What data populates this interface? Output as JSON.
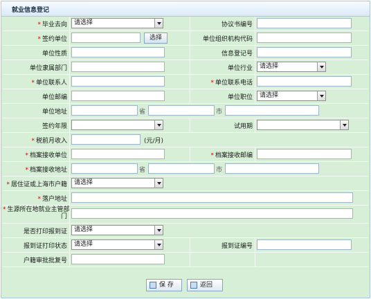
{
  "header": {
    "title": "就业信息登记"
  },
  "rows": {
    "r1": {
      "left_label": "毕业去向",
      "left_select": "请选择",
      "right_label": "协议书编号"
    },
    "r2": {
      "left_label": "签约单位",
      "choose_button": "选择",
      "right_label": "单位组织机构代码"
    },
    "r3": {
      "left_label": "单位性质",
      "right_label": "信息登记号"
    },
    "r4": {
      "left_label": "单位隶属部门",
      "right_label": "单位行业",
      "right_select": "请选择"
    },
    "r5": {
      "left_label": "单位联系人",
      "right_label": "单位联系电话"
    },
    "r6": {
      "left_label": "单位邮编",
      "right_label": "单位职位",
      "right_select": "请选择"
    },
    "r7": {
      "left_label": "单位地址",
      "province": "省",
      "city": "市"
    },
    "r8": {
      "left_label": "签约年限",
      "left_select": "",
      "right_label": "试用期",
      "right_select": ""
    },
    "r9": {
      "left_label": "税前月收入",
      "unit": "(元/月)"
    },
    "r10": {
      "left_label": "档案接收单位",
      "right_label": "档案接收邮编"
    },
    "r11": {
      "left_label": "档案接收地址",
      "province": "省",
      "city": "市"
    },
    "r12": {
      "left_label": "居住证或上海市户籍",
      "left_select": "请选择"
    },
    "r13": {
      "left_label": "落户地址"
    },
    "r14": {
      "left_label_line1": "生源所在地就业主管部",
      "left_label_line2": "门"
    },
    "r15": {
      "left_label": "是否打印报到证",
      "left_select": "请选择"
    },
    "r16": {
      "left_label": "报到证打印状态",
      "left_select": "请选择",
      "right_label": "报到证编号"
    },
    "r17": {
      "left_label": "户籍审批批复号"
    }
  },
  "footer": {
    "save_label": "保 存",
    "back_label": "返回"
  },
  "colors": {
    "panel_bg": "#d7efd7",
    "required_mark": "#d40000",
    "border": "#a9c8df"
  }
}
